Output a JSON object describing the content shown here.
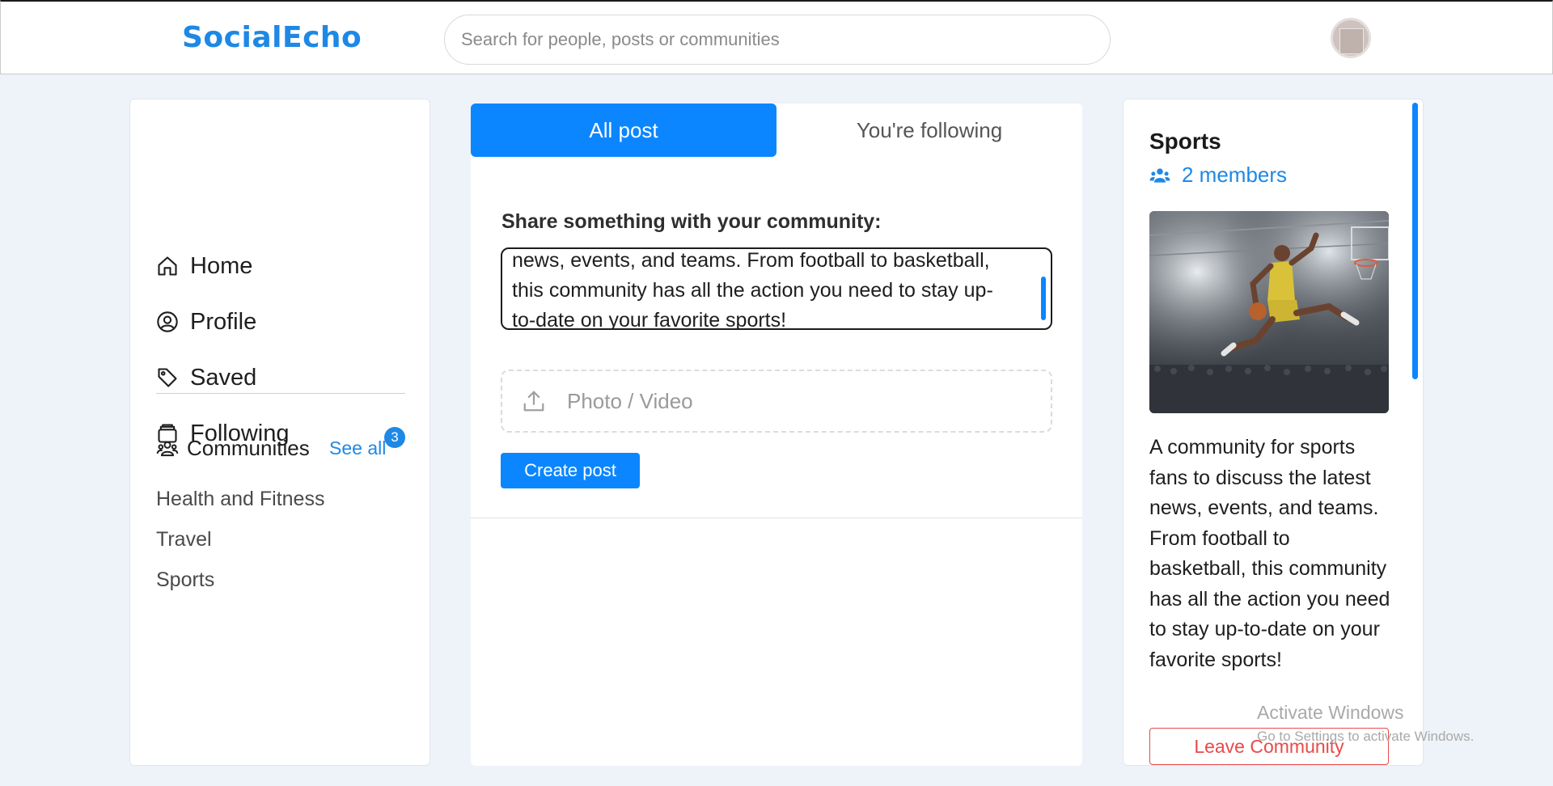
{
  "header": {
    "logo": "SocialEcho",
    "search_placeholder": "Search for people, posts or communities"
  },
  "sidebar": {
    "nav": [
      {
        "label": "Home",
        "icon": "home-icon"
      },
      {
        "label": "Profile",
        "icon": "user-circle-icon"
      },
      {
        "label": "Saved",
        "icon": "tag-icon"
      },
      {
        "label": "Following",
        "icon": "inbox-icon"
      }
    ],
    "communities_label": "Communities",
    "see_all": "See all",
    "badge_count": "3",
    "communities": [
      "Health and Fitness",
      "Travel",
      "Sports"
    ]
  },
  "feed": {
    "tabs": [
      "All post",
      "You're following"
    ],
    "active_tab": "All post",
    "share_label": "Share something with your community:",
    "compose_text": "news, events, and teams. From football to basketball,\nthis community has all the action you need to stay up-\nto-date on your favorite sports!",
    "upload_label": "Photo / Video",
    "create_button": "Create post"
  },
  "community": {
    "title": "Sports",
    "members": "2 members",
    "description": "A community for sports fans to discuss the latest news, events, and teams. From football to basketball, this community has all the action you need to stay up-to-date on your favorite sports!",
    "leave_button": "Leave Community"
  },
  "watermark": {
    "line1": "Activate Windows",
    "line2": "Go to Settings to activate Windows."
  },
  "colors": {
    "accent": "#0b86ff",
    "brand": "#1e88e5",
    "danger": "#e84a4a",
    "background": "#eef3f9"
  }
}
